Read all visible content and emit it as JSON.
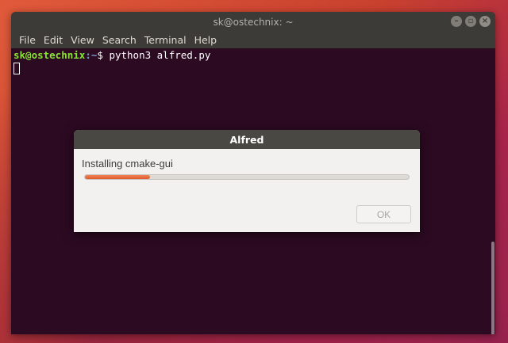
{
  "terminal": {
    "title": "sk@ostechnix: ~",
    "window_buttons": [
      "–",
      "▫",
      "×"
    ],
    "menu": [
      "File",
      "Edit",
      "View",
      "Search",
      "Terminal",
      "Help"
    ],
    "prompt_user": "sk@ostechnix",
    "prompt_path": ":~",
    "prompt_symbol": "$ ",
    "command": "python3 alfred.py"
  },
  "dialog": {
    "title": "Alfred",
    "status": "Installing cmake-gui",
    "progress": 0.2,
    "ok_label": "OK",
    "ok_enabled": false
  },
  "colors": {
    "terminal_bg": "#2c0a22",
    "prompt_user": "#8ae234",
    "prompt_path": "#729fcf",
    "progress_fill": "#e0582e"
  }
}
